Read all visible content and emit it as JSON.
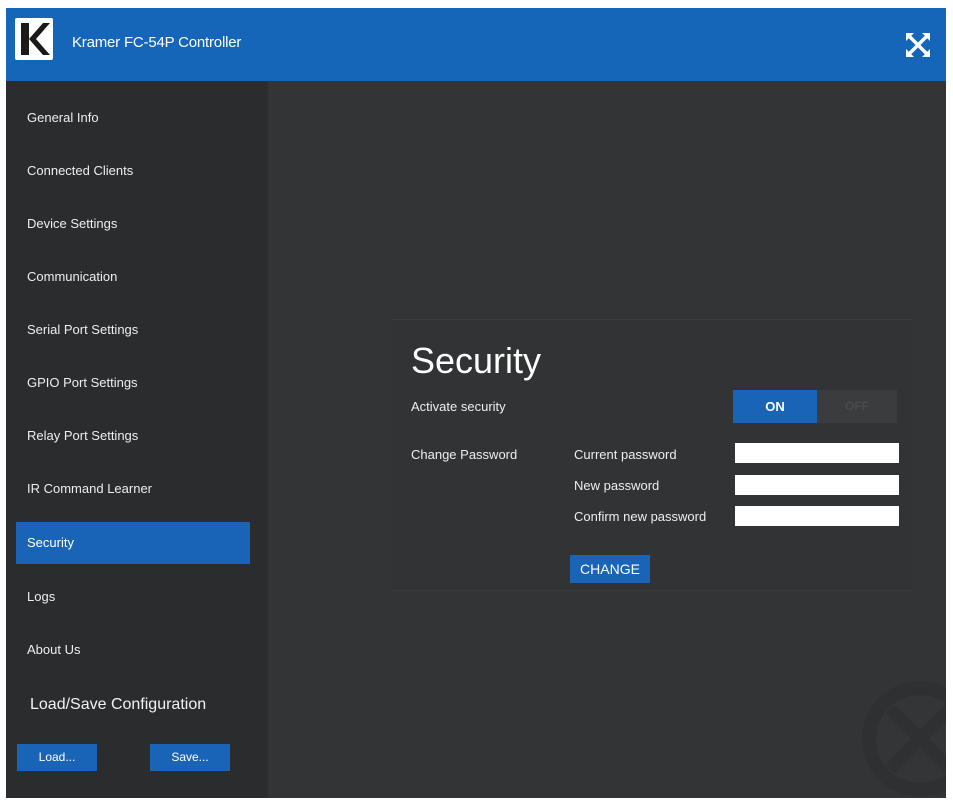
{
  "header": {
    "title": "Kramer FC-54P Controller",
    "close_icon": "close-x-icon",
    "background": "#1565b8"
  },
  "sidebar": {
    "items": [
      {
        "label": "General Info"
      },
      {
        "label": "Connected Clients"
      },
      {
        "label": "Device Settings"
      },
      {
        "label": "Communication"
      },
      {
        "label": "Serial Port Settings"
      },
      {
        "label": "GPIO Port Settings"
      },
      {
        "label": "Relay Port Settings"
      },
      {
        "label": "IR Command Learner"
      },
      {
        "label": "Security",
        "active": true
      },
      {
        "label": "Logs"
      },
      {
        "label": "About Us"
      }
    ],
    "config_title": "Load/Save Configuration",
    "load_label": "Load...",
    "save_label": "Save...",
    "active_color": "#1a64b7"
  },
  "security": {
    "title": "Security",
    "activate_label": "Activate security",
    "toggle_on": "ON",
    "toggle_off": "OFF",
    "toggle_state": "ON",
    "change_password_label": "Change Password",
    "current_password_label": "Current password",
    "new_password_label": "New password",
    "confirm_password_label": "Confirm new password",
    "current_password_value": "",
    "new_password_value": "",
    "confirm_password_value": "",
    "change_button": "CHANGE"
  }
}
